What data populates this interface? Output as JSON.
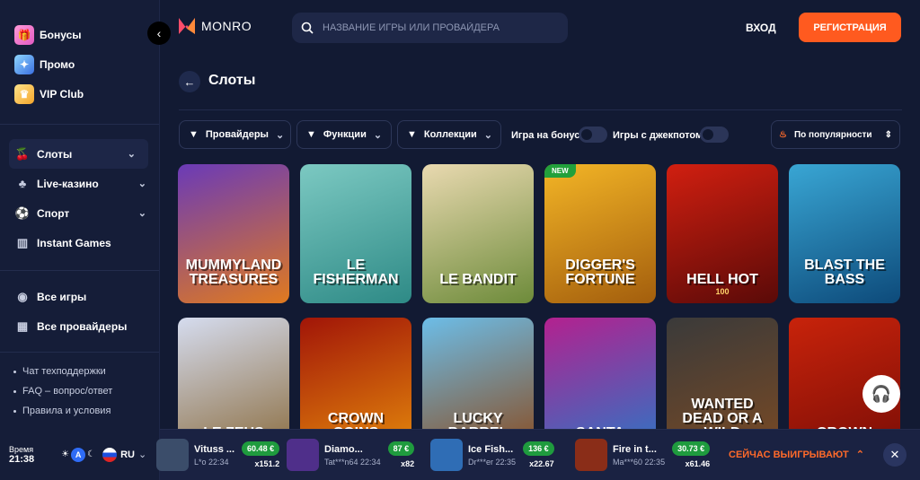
{
  "sidebar": {
    "promo": [
      {
        "label": "Бонусы",
        "icon": "gift-icon"
      },
      {
        "label": "Промо",
        "icon": "promo-icon"
      },
      {
        "label": "VIP Club",
        "icon": "crown-icon"
      }
    ],
    "nav": [
      {
        "label": "Слоты",
        "icon": "cherries-icon",
        "active": true
      },
      {
        "label": "Live-казино",
        "icon": "cards-icon"
      },
      {
        "label": "Спорт",
        "icon": "ball-icon"
      },
      {
        "label": "Instant Games",
        "icon": "chart-icon"
      }
    ],
    "lobby": [
      {
        "label": "Все игры",
        "icon": "games-icon"
      },
      {
        "label": "Все провайдеры",
        "icon": "grid-icon"
      }
    ],
    "links": [
      "Чат техподдержки",
      "FAQ – вопрос/ответ",
      "Правила и условия"
    ],
    "time_label": "Время",
    "time_value": "21:38",
    "theme_label": "A",
    "language": "RU"
  },
  "header": {
    "brand": "MONRO",
    "search_placeholder": "НАЗВАНИЕ ИГРЫ ИЛИ ПРОВАЙДЕРА",
    "login": "ВХОД",
    "register": "РЕГИСТРАЦИЯ"
  },
  "page": {
    "title": "Слоты"
  },
  "filters": {
    "providers": "Провайдеры",
    "features": "Функции",
    "collections": "Коллекции",
    "bonus_toggle": "Игра на бонус",
    "jackpot_toggle": "Игры с джекпотом",
    "sort": "По популярности"
  },
  "games": [
    {
      "title": "Mummyland Treasures",
      "colors": [
        "#6a3ab8",
        "#e07a1f"
      ]
    },
    {
      "title": "Le Fisherman",
      "colors": [
        "#7cc9c2",
        "#2e8a86"
      ]
    },
    {
      "title": "Le Bandit",
      "colors": [
        "#e9d9b0",
        "#6d8b3a"
      ]
    },
    {
      "title": "Digger's Fortune",
      "colors": [
        "#f3b526",
        "#a35e0d"
      ],
      "badge": "NEW"
    },
    {
      "title": "Hell Hot",
      "sub": "100",
      "colors": [
        "#d11f10",
        "#5a0a08"
      ]
    },
    {
      "title": "Blast the Bass",
      "colors": [
        "#39a6d4",
        "#0d4a7a"
      ]
    },
    {
      "title": "Le Zeus",
      "colors": [
        "#d5dcef",
        "#8a6b3c"
      ]
    },
    {
      "title": "Crown Coins",
      "colors": [
        "#a11508",
        "#e58a0c"
      ]
    },
    {
      "title": "Lucky Barrel",
      "colors": [
        "#6cbde8",
        "#8a4a1d"
      ]
    },
    {
      "title": "Santa",
      "colors": [
        "#b3218f",
        "#2b77c6"
      ]
    },
    {
      "title": "Wanted Dead or a Wild",
      "colors": [
        "#3a3a3a",
        "#7a4a24"
      ]
    },
    {
      "title": "Crown",
      "colors": [
        "#c8230b",
        "#7a0d06"
      ]
    }
  ],
  "ticker": {
    "items": [
      {
        "name": "Vituss ...",
        "user": "L*o",
        "time": "22:34",
        "amount": "60.48 €",
        "mult": "x151.2",
        "color": "#3b4d6a"
      },
      {
        "name": "Diamo...",
        "user": "Tat***n64",
        "time": "22:34",
        "amount": "87 €",
        "mult": "x82",
        "color": "#4f2f8a"
      },
      {
        "name": "Ice Fish...",
        "user": "Dr***er",
        "time": "22:35",
        "amount": "136 €",
        "mult": "x22.67",
        "color": "#2f6db5"
      },
      {
        "name": "Fire in t...",
        "user": "Ma***60",
        "time": "22:35",
        "amount": "30.73 €",
        "mult": "x61.46",
        "color": "#8a2d18"
      }
    ],
    "winning_now": "СЕЙЧАС ВЫИГРЫВАЮТ"
  }
}
